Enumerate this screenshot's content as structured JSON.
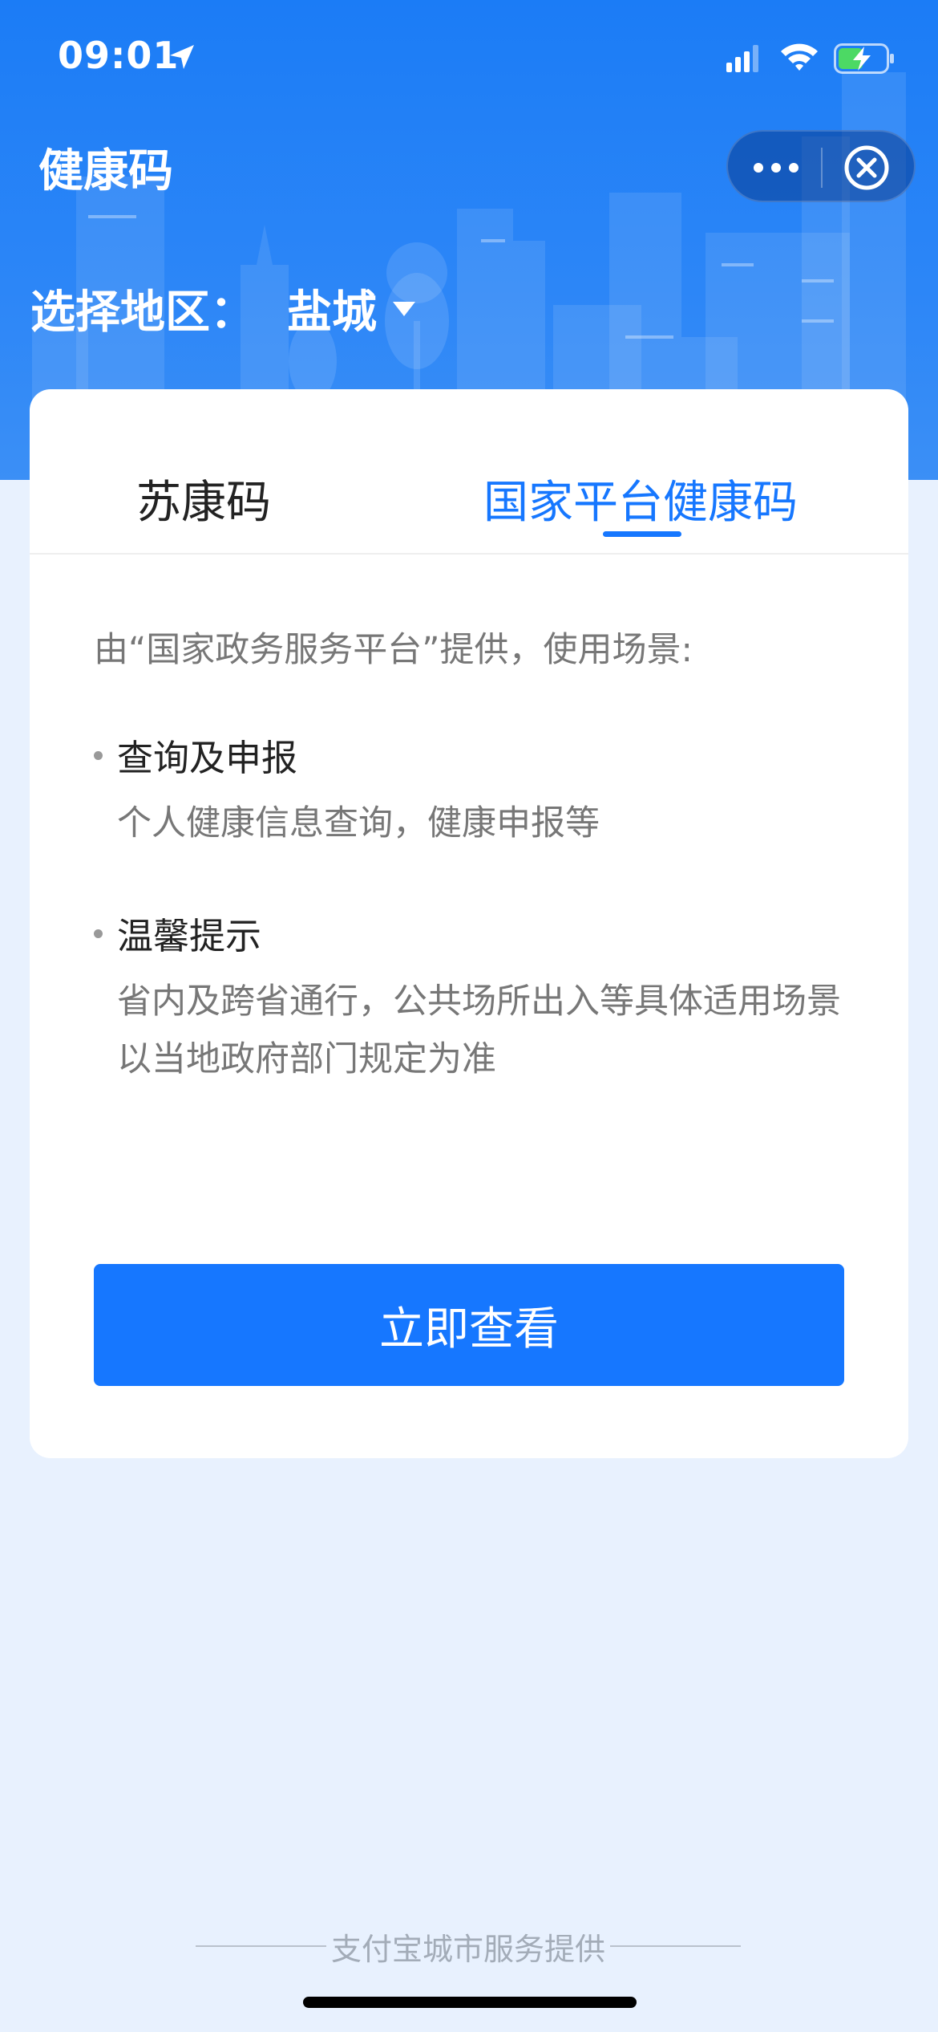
{
  "status_bar": {
    "time": "09:01",
    "icons": [
      "location-arrow-icon",
      "signal-icon",
      "wifi-icon",
      "battery-charging-icon"
    ]
  },
  "header": {
    "title": "健康码",
    "capsule": {
      "more_icon": "more-icon",
      "close_icon": "close-circle-icon"
    }
  },
  "region": {
    "label": "选择地区：",
    "city": "盐城",
    "caret_icon": "caret-down-icon"
  },
  "tabs": [
    {
      "label": "苏康码",
      "active": false
    },
    {
      "label": "国家平台健康码",
      "active": true
    }
  ],
  "content": {
    "intro": "由“国家政务服务平台”提供，使用场景:",
    "items": [
      {
        "title": "查询及申报",
        "desc": "个人健康信息查询，健康申报等"
      },
      {
        "title": "温馨提示",
        "desc": "省内及跨省通行，公共场所出入等具体适用场景以当地政府部门规定为准"
      }
    ]
  },
  "button": {
    "label": "立即查看"
  },
  "footer": {
    "text": "支付宝城市服务提供"
  },
  "colors": {
    "brand_blue": "#1677ff",
    "header_blue": "#1b7cf6",
    "page_bg": "#e8f1fe",
    "battery_green": "#4cd964"
  }
}
